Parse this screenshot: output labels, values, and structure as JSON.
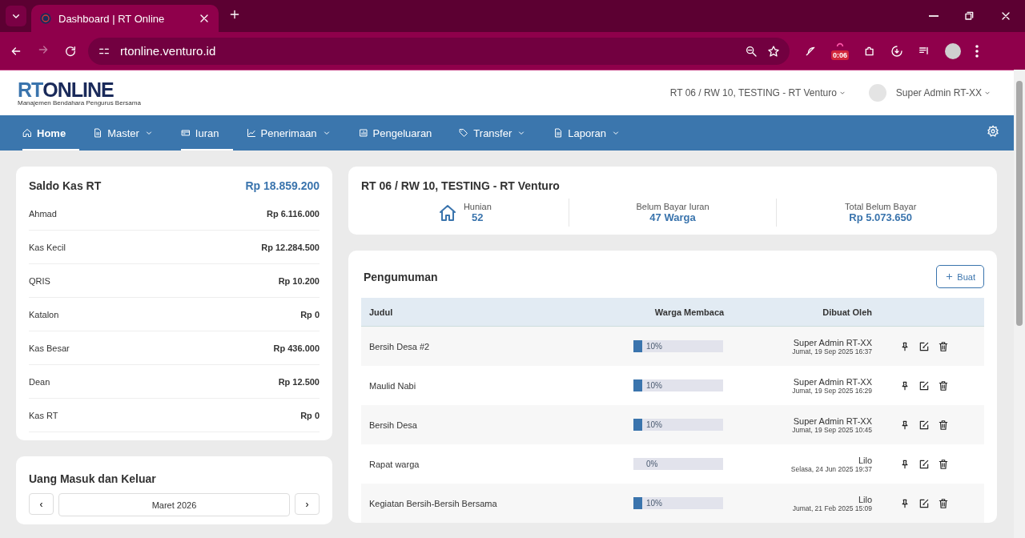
{
  "browser": {
    "tab_title": "Dashboard | RT Online",
    "url": "rtonline.venturo.id",
    "timer_badge": "0:06"
  },
  "header": {
    "logo_main": "RT",
    "logo_rest": "ONLINE",
    "logo_tagline": "Manajemen Bendahara Pengurus Bersama",
    "org_selector": "RT 06 / RW 10, TESTING - RT Venturo",
    "user_name": "Super Admin RT-XX"
  },
  "nav": [
    {
      "label": "Home",
      "kind": "home",
      "dropdown": false,
      "selected": true,
      "hovered": false
    },
    {
      "label": "Master",
      "kind": "file",
      "dropdown": true,
      "selected": false,
      "hovered": false
    },
    {
      "label": "Iuran",
      "kind": "card",
      "dropdown": false,
      "selected": false,
      "hovered": true
    },
    {
      "label": "Penerimaan",
      "kind": "chart",
      "dropdown": true,
      "selected": false,
      "hovered": false
    },
    {
      "label": "Pengeluaran",
      "kind": "bars",
      "dropdown": false,
      "selected": false,
      "hovered": false
    },
    {
      "label": "Transfer",
      "kind": "tag",
      "dropdown": true,
      "selected": false,
      "hovered": false
    },
    {
      "label": "Laporan",
      "kind": "file",
      "dropdown": true,
      "selected": false,
      "hovered": false
    }
  ],
  "saldo": {
    "title": "Saldo Kas RT",
    "total": "Rp 18.859.200",
    "rows": [
      {
        "name": "Ahmad",
        "amount": "Rp 6.116.000"
      },
      {
        "name": "Kas Kecil",
        "amount": "Rp 12.284.500"
      },
      {
        "name": "QRIS",
        "amount": "Rp 10.200"
      },
      {
        "name": "Katalon",
        "amount": "Rp 0"
      },
      {
        "name": "Kas Besar",
        "amount": "Rp 436.000"
      },
      {
        "name": "Dean",
        "amount": "Rp 12.500"
      },
      {
        "name": "Kas RT",
        "amount": "Rp 0"
      }
    ]
  },
  "cashflow": {
    "title": "Uang Masuk dan Keluar",
    "prev": "‹",
    "month": "Maret 2026",
    "next": "›"
  },
  "summary": {
    "title": "RT 06 / RW 10, TESTING - RT Venturo",
    "stats": [
      {
        "label": "Hunian",
        "value": "52",
        "kind": "house"
      },
      {
        "label": "Belum Bayar Iuran",
        "value": "47 Warga",
        "kind": "plain"
      },
      {
        "label": "Total Belum Bayar",
        "value": "Rp 5.073.650",
        "kind": "plain"
      }
    ]
  },
  "announcements": {
    "title": "Pengumuman",
    "create_button": "Buat",
    "columns": [
      "Judul",
      "Warga Membaca",
      "Dibuat Oleh"
    ],
    "rows": [
      {
        "title": "Bersih Desa #2",
        "level": 0.1,
        "percent": "10%",
        "author": "Super Admin RT-XX",
        "date": "Jumat, 19 Sep 2025 16:37"
      },
      {
        "title": "Maulid Nabi",
        "level": 0.1,
        "percent": "10%",
        "author": "Super Admin RT-XX",
        "date": "Jumat, 19 Sep 2025 16:29"
      },
      {
        "title": "Bersih Desa",
        "level": 0.1,
        "percent": "10%",
        "author": "Super Admin RT-XX",
        "date": "Jumat, 19 Sep 2025 10:45"
      },
      {
        "title": "Rapat warga",
        "level": 0,
        "percent": "0%",
        "author": "Lilo",
        "date": "Selasa, 24 Jun 2025 19:37"
      },
      {
        "title": "Kegiatan Bersih-Bersih Bersama",
        "level": 0.1,
        "percent": "10%",
        "author": "Lilo",
        "date": "Jumat, 21 Feb 2025 15:09"
      }
    ]
  }
}
